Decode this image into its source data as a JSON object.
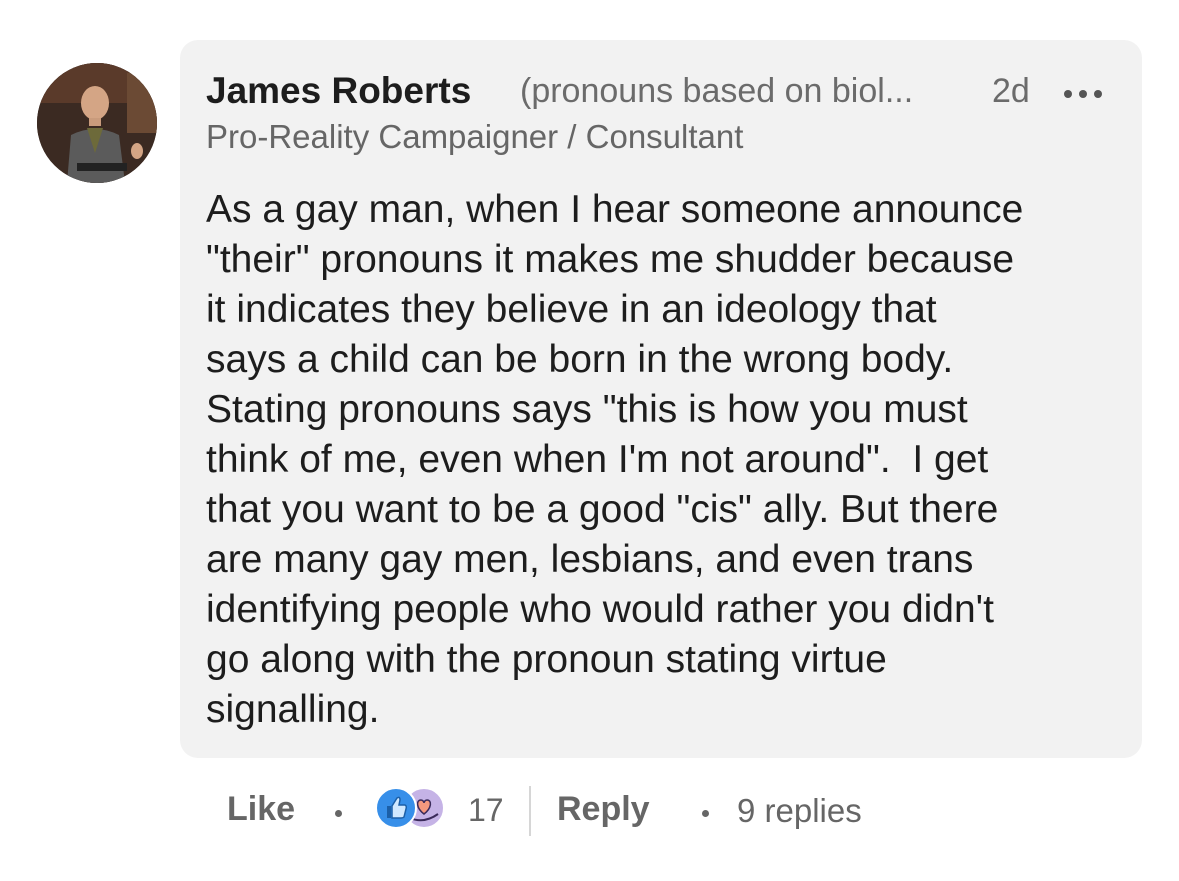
{
  "comment": {
    "author": "James Roberts",
    "pronouns": "(pronouns based on biol...",
    "time": "2d",
    "headline": "Pro-Reality Campaigner / Consultant",
    "body_lines": [
      "As a gay man, when I hear someone announce",
      "\"their\" pronouns it makes me shudder because",
      "it indicates they believe in an ideology that",
      "says a child can be born in the wrong body.",
      "Stating pronouns says \"this is how you must",
      "think of me, even when I'm not around\".  I get",
      "that you want to be a good \"cis\" ally. But there",
      "are many gay men, lesbians, and even trans",
      "identifying people who would rather you didn't",
      "go along with the pronoun stating virtue",
      "signalling."
    ]
  },
  "footer": {
    "like_label": "Like",
    "reaction_count": "17",
    "reply_label": "Reply",
    "replies_label": "9 replies"
  },
  "icons": {
    "more": "more-horizontal-icon",
    "like_reaction": "thumbs-up-reaction-icon",
    "support_reaction": "heart-hand-reaction-icon"
  },
  "colors": {
    "bubble": "#f2f2f2",
    "like_blue": "#378fe9",
    "support_purple": "#c5b3e6"
  }
}
